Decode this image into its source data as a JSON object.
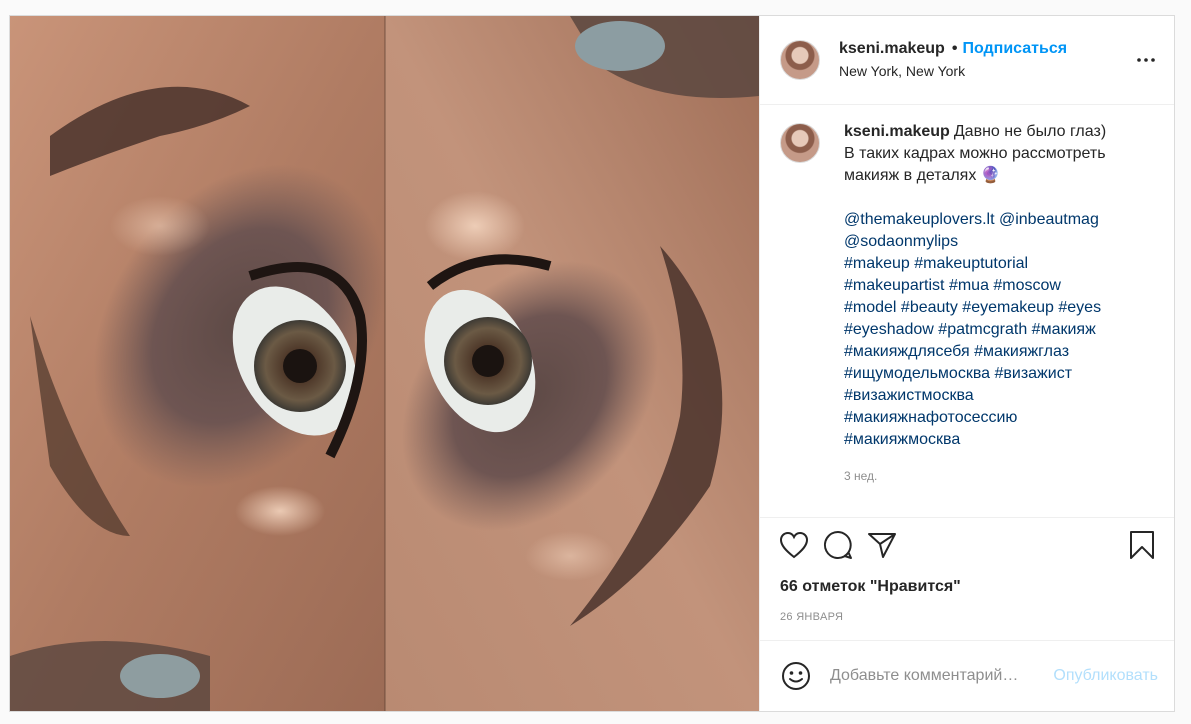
{
  "post": {
    "username": "kseni.makeup",
    "dot": "•",
    "follow_label": "Подписаться",
    "location": "New York, New York"
  },
  "caption": {
    "username": "kseni.makeup",
    "lines": [
      "Давно не было глаз)",
      "В таких кадрах можно рассмотреть",
      "макияж в деталях 🔮",
      "",
      "@themakeuplovers.lt @inbeautmag",
      "@sodaonmylips",
      "#makeup #makeuptutorial",
      "#makeupartist #mua #moscow",
      "#model #beauty #eyemakeup #eyes",
      "#eyeshadow #patmcgrath #макияж",
      "#макияждлясебя #макияжглаз",
      "#ищумодельмосква #визажист",
      "#визажистмосква",
      "#макияжнафотосессию",
      "#макияжмосква"
    ],
    "time_ago": "3 нед."
  },
  "likes_text": "66 отметок \"Нравится\"",
  "date": "26 ЯНВАРЯ",
  "comment": {
    "placeholder": "Добавьте комментарий…",
    "publish_label": "Опубликовать"
  },
  "icons": {
    "more": "more-options-icon",
    "like": "heart-icon",
    "comment": "comment-icon",
    "share": "share-icon",
    "save": "bookmark-icon",
    "emoji": "emoji-icon"
  },
  "colors": {
    "accent": "#0095f6",
    "hashtag": "#00376b",
    "muted": "#8e8e8e"
  }
}
